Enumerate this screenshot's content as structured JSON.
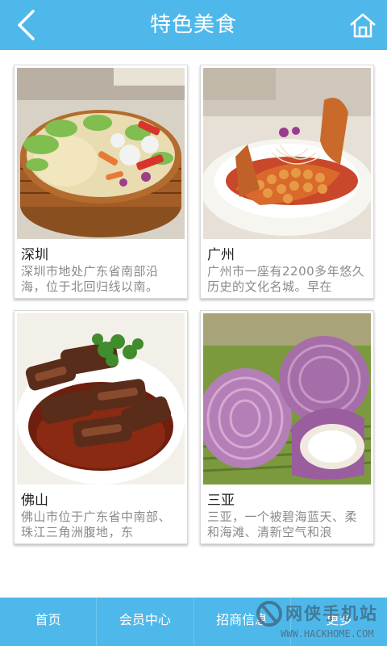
{
  "header": {
    "title": "特色美食"
  },
  "cards": [
    {
      "name": "深圳",
      "desc": "深圳市地处广东省南部沿海，位于北回归线以南。"
    },
    {
      "name": "广州",
      "desc": "广州市一座有2200多年悠久历史的文化名城。早在"
    },
    {
      "name": "佛山",
      "desc": "佛山市位于广东省中南部、珠江三角洲腹地，东"
    },
    {
      "name": "三亚",
      "desc": "三亚，一个被碧海蓝天、柔和海滩、清新空气和浪"
    }
  ],
  "footer": {
    "tabs": [
      "首页",
      "会员中心",
      "招商信息",
      "更多"
    ]
  },
  "watermark": {
    "text": "网侠手机站",
    "url": "WWW.HACKHOME.COM"
  },
  "icons": {
    "back": "chevron-left-icon",
    "home": "home-icon"
  },
  "colors": {
    "header_bg": "#4fb8ea",
    "footer_bg": "#4fb8ea"
  }
}
